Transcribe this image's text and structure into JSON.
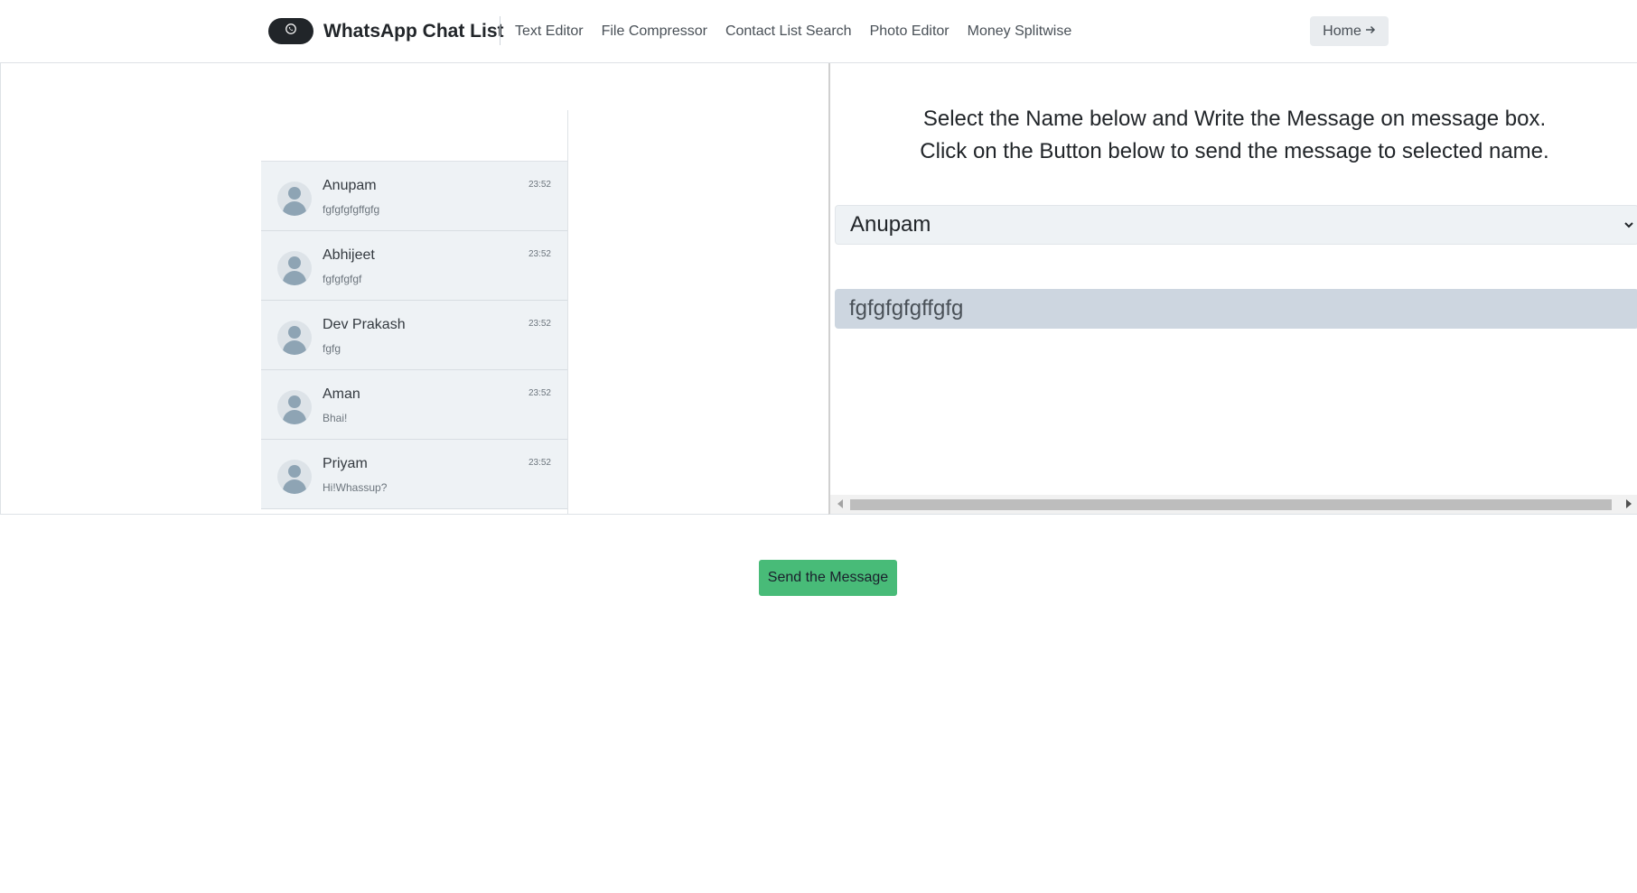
{
  "header": {
    "brand": "WhatsApp Chat List",
    "nav": [
      "Text Editor",
      "File Compressor",
      "Contact List Search",
      "Photo Editor",
      "Money Splitwise"
    ],
    "home_label": "Home",
    "home_icon": "arrow-right-icon",
    "logo_icon": "whatsapp-icon"
  },
  "chats": [
    {
      "name": "Anupam",
      "message": "fgfgfgfgffgfg",
      "time": "23:52"
    },
    {
      "name": "Abhijeet",
      "message": "fgfgfgfgf",
      "time": "23:52"
    },
    {
      "name": "Dev Prakash",
      "message": "fgfg",
      "time": "23:52"
    },
    {
      "name": "Aman",
      "message": "Bhai!",
      "time": "23:52"
    },
    {
      "name": "Priyam",
      "message": "Hi!Whassup?",
      "time": "23:52"
    }
  ],
  "compose": {
    "instruction_line1": "Select the Name below and Write the Message on message box.",
    "instruction_line2": "Click on the Button below to send the message to selected name.",
    "selected_name": "Anupam",
    "message_value": "fgfgfgfgffgfg",
    "send_label": "Send the Message"
  },
  "colors": {
    "send_button": "#48bb78",
    "chat_item_bg": "#eef2f5",
    "message_box_bg": "#cdd6e0",
    "logo_bg": "#212529"
  }
}
